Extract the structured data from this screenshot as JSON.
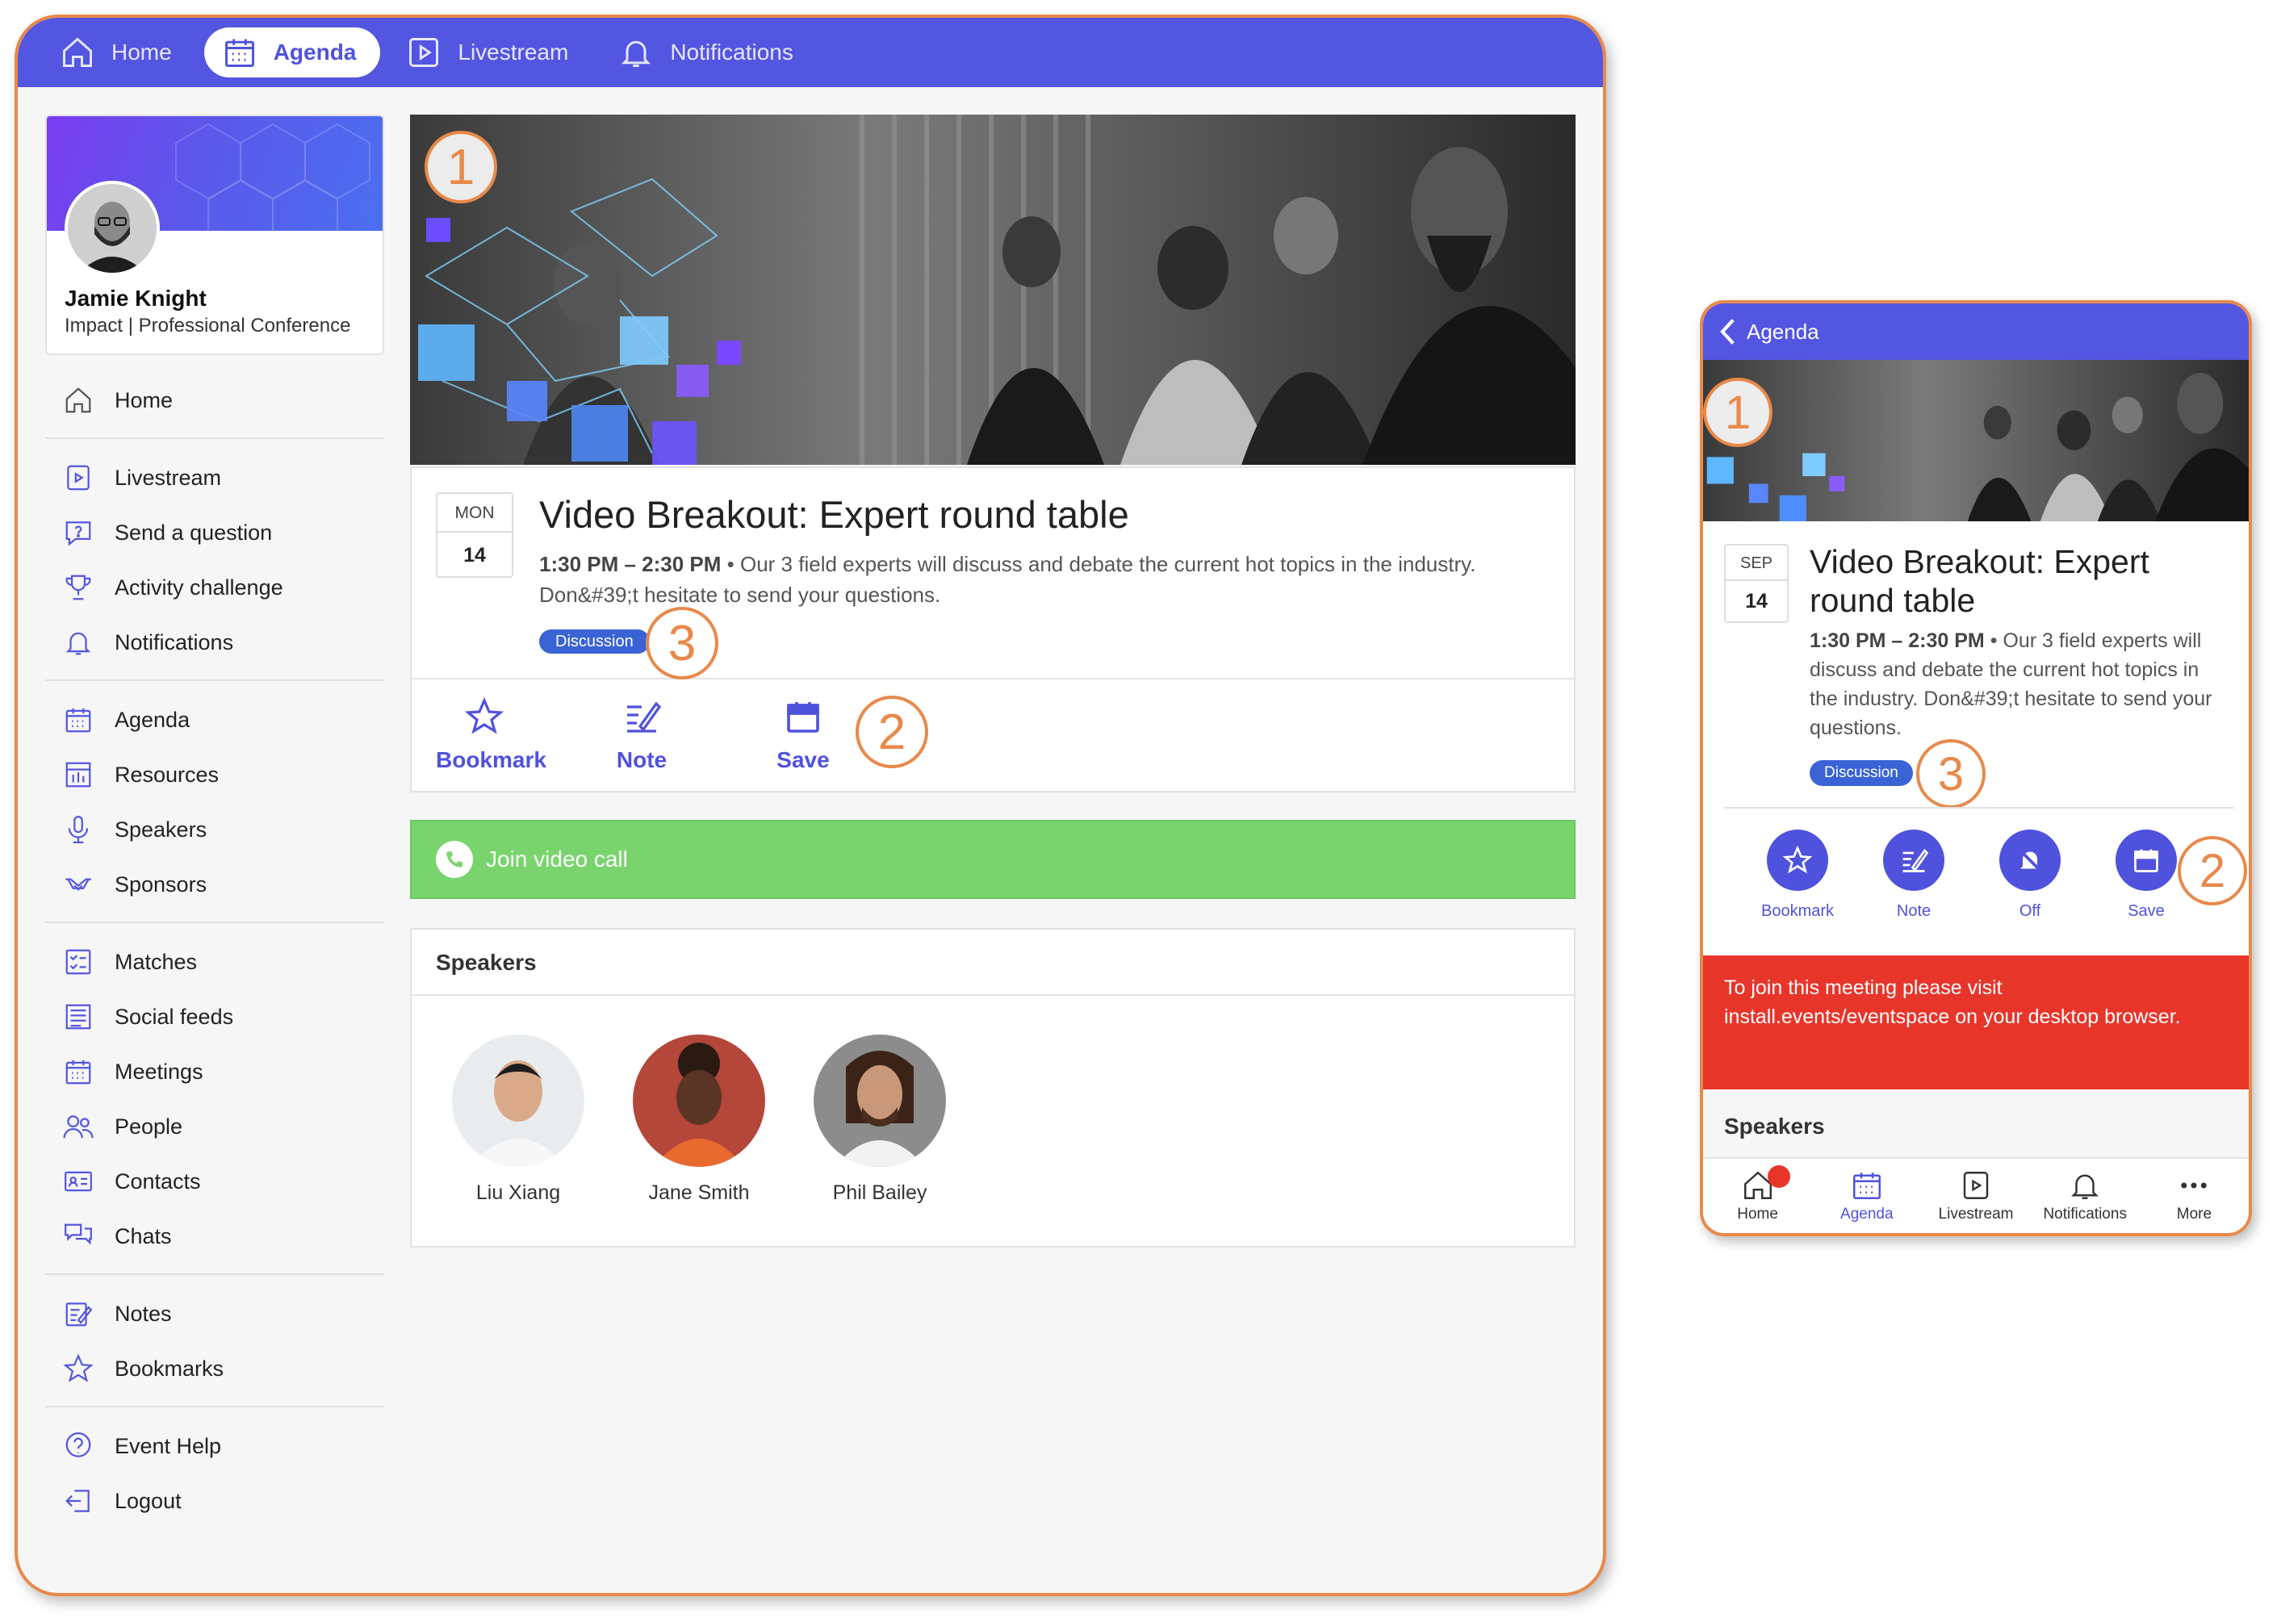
{
  "desktop": {
    "topbar": {
      "items": [
        {
          "label": "Home",
          "icon": "home-icon",
          "active": false
        },
        {
          "label": "Agenda",
          "icon": "calendar-icon",
          "active": true
        },
        {
          "label": "Livestream",
          "icon": "play-icon",
          "active": false
        },
        {
          "label": "Notifications",
          "icon": "bell-icon",
          "active": false
        }
      ]
    },
    "profile": {
      "name": "Jamie Knight",
      "subtitle": "Impact | Professional Conference"
    },
    "sidebar": {
      "groups": [
        [
          {
            "label": "Home",
            "icon": "home-icon"
          }
        ],
        [
          {
            "label": "Livestream",
            "icon": "play-icon"
          },
          {
            "label": "Send a question",
            "icon": "question-icon"
          },
          {
            "label": "Activity challenge",
            "icon": "trophy-icon"
          },
          {
            "label": "Notifications",
            "icon": "bell-icon"
          }
        ],
        [
          {
            "label": "Agenda",
            "icon": "calendar-icon"
          },
          {
            "label": "Resources",
            "icon": "resources-icon"
          },
          {
            "label": "Speakers",
            "icon": "microphone-icon"
          },
          {
            "label": "Sponsors",
            "icon": "handshake-icon"
          }
        ],
        [
          {
            "label": "Matches",
            "icon": "checklist-icon"
          },
          {
            "label": "Social feeds",
            "icon": "feed-icon"
          },
          {
            "label": "Meetings",
            "icon": "calendar-icon"
          },
          {
            "label": "People",
            "icon": "people-icon"
          },
          {
            "label": "Contacts",
            "icon": "contact-card-icon"
          },
          {
            "label": "Chats",
            "icon": "chat-icon"
          }
        ],
        [
          {
            "label": "Notes",
            "icon": "note-icon"
          },
          {
            "label": "Bookmarks",
            "icon": "star-icon"
          }
        ],
        [
          {
            "label": "Event Help",
            "icon": "help-icon"
          },
          {
            "label": "Logout",
            "icon": "logout-icon"
          }
        ]
      ]
    },
    "session": {
      "weekday": "MON",
      "day": "14",
      "title": "Video Breakout: Expert round table",
      "time": "1:30 PM – 2:30 PM",
      "description": " • Our 3 field experts will discuss and debate the current hot topics in the industry. Don&#39;t hesitate to send your questions.",
      "tag": "Discussion",
      "actions": {
        "bookmark": "Bookmark",
        "note": "Note",
        "save": "Save"
      }
    },
    "join_label": "Join video call",
    "speakers_heading": "Speakers",
    "speakers": [
      {
        "name": "Liu Xiang"
      },
      {
        "name": "Jane Smith"
      },
      {
        "name": "Phil Bailey"
      }
    ],
    "callouts": {
      "hero": "1",
      "save": "2",
      "tag": "3"
    }
  },
  "mobile": {
    "back_label": "Agenda",
    "session": {
      "month": "SEP",
      "day": "14",
      "title": "Video Breakout: Expert round table",
      "time": "1:30 PM – 2:30 PM",
      "description": " • Our 3 field experts will discuss and debate the current hot topics in the industry. Don&#39;t hesitate to send your questions.",
      "tag": "Discussion"
    },
    "actions": {
      "bookmark": "Bookmark",
      "note": "Note",
      "off": "Off",
      "save": "Save"
    },
    "alert": "To join this meeting please visit install.events/eventspace on your desktop browser.",
    "speakers_heading": "Speakers",
    "tabbar": [
      {
        "label": "Home",
        "icon": "home-icon"
      },
      {
        "label": "Agenda",
        "icon": "calendar-icon",
        "active": true
      },
      {
        "label": "Livestream",
        "icon": "play-icon"
      },
      {
        "label": "Notifications",
        "icon": "bell-icon"
      },
      {
        "label": "More",
        "icon": "more-icon"
      }
    ],
    "callouts": {
      "hero": "1",
      "save": "2",
      "tag": "3"
    }
  },
  "colors": {
    "accent": "#5356e0",
    "callout": "#e8894a",
    "join_green": "#79d46d",
    "alert_red": "#e8352a",
    "tag_blue": "#3a63d6"
  }
}
